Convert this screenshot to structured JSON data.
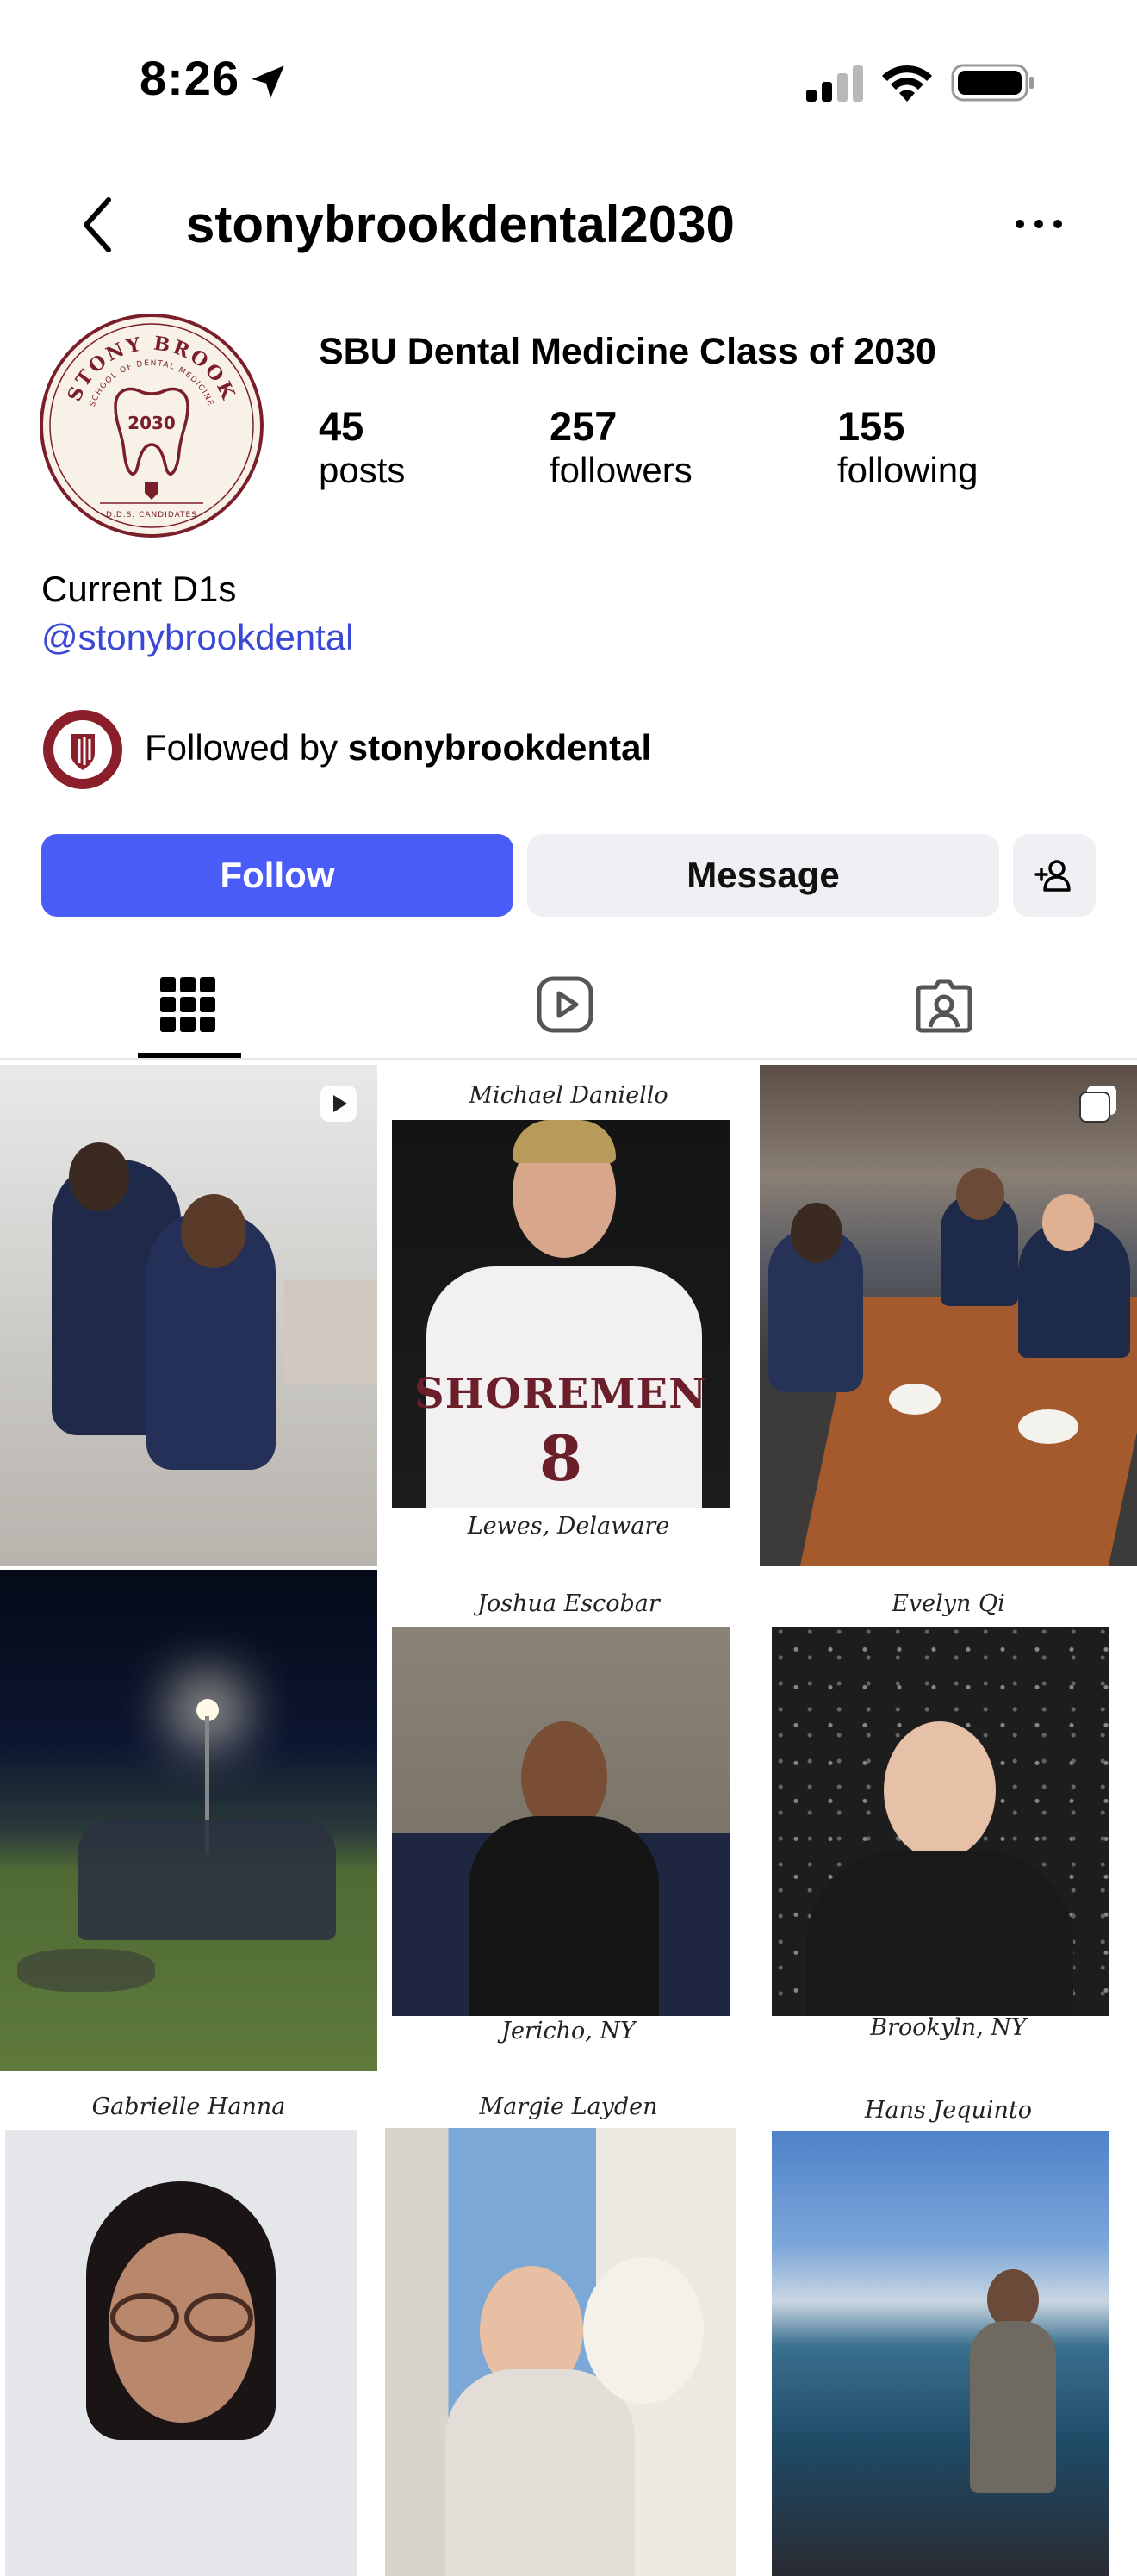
{
  "status_bar": {
    "time": "8:26"
  },
  "header": {
    "username": "stonybrookdental2030"
  },
  "profile": {
    "avatar_text": {
      "top": "STONY BROOK",
      "sub": "SCHOOL OF DENTAL MEDICINE",
      "year": "2030",
      "bottom": "D.D.S. CANDIDATES"
    },
    "display_name": "SBU Dental Medicine Class of 2030",
    "stats": [
      {
        "value": "45",
        "label": "posts"
      },
      {
        "value": "257",
        "label": "followers"
      },
      {
        "value": "155",
        "label": "following"
      }
    ],
    "bio": "Current D1s",
    "bio_link": "@stonybrookdental",
    "followed_by_prefix": "Followed by ",
    "followed_by_user": "stonybrookdental"
  },
  "actions": {
    "follow": "Follow",
    "message": "Message"
  },
  "tabs": [
    "grid-icon",
    "reels-icon",
    "tagged-icon"
  ],
  "grid": [
    {
      "type": "photo",
      "badge": "reel-icon"
    },
    {
      "type": "card",
      "name": "Michael Daniello",
      "place": "Lewes, Delaware",
      "jersey_text": "SHOREMEN",
      "jersey_number": "8"
    },
    {
      "type": "photo",
      "badge": "carousel-icon"
    },
    {
      "type": "photo"
    },
    {
      "type": "card",
      "name": "Joshua Escobar",
      "place": "Jericho, NY"
    },
    {
      "type": "card",
      "name": "Evelyn Qi",
      "place": "Brookyln, NY"
    },
    {
      "type": "card",
      "name": "Gabrielle Hanna",
      "place": ""
    },
    {
      "type": "card",
      "name": "Margie Layden",
      "place": ""
    },
    {
      "type": "card",
      "name": "Hans Jequinto",
      "place": ""
    }
  ],
  "colors": {
    "accent": "#4a5cf7",
    "link": "#3b48d6",
    "brand": "#8b1e2b"
  }
}
